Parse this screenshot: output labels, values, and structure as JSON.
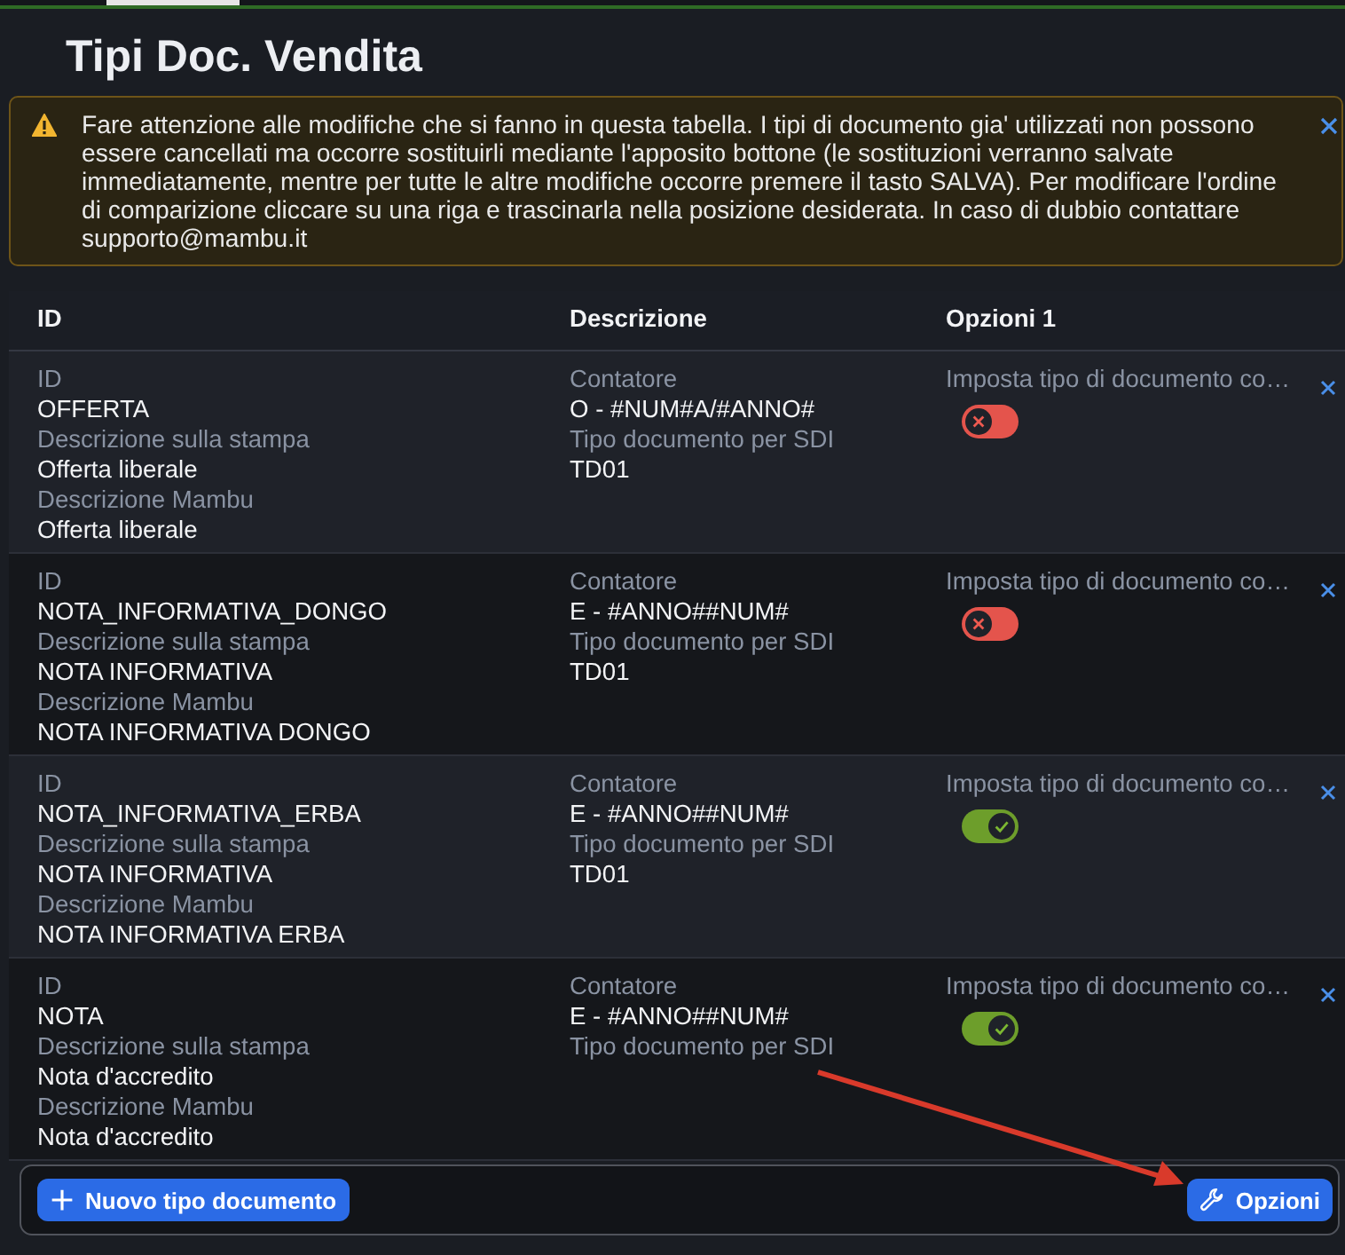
{
  "title": "Tipi Doc. Vendita",
  "alert": {
    "text": "Fare attenzione alle modifiche che si fanno in questa tabella. I tipi di documento gia' utilizzati non possono essere cancellati ma occorre sostituirli mediante l'apposito bottone (le sostituzioni verranno salvate immediatamente, mentre per tutte le altre modifiche occorre premere il tasto SALVA). Per modificare l'ordine di comparizione cliccare su una riga e trascinarla nella posizione desiderata. In caso di dubbio contattare supporto@mambu.it"
  },
  "table": {
    "columns": [
      "ID",
      "Descrizione",
      "Opzioni 1"
    ],
    "rows": [
      {
        "column_1": [
          {
            "label": "ID",
            "value": "OFFERTA"
          },
          {
            "label": "Descrizione sulla stampa",
            "value": "Offerta liberale"
          },
          {
            "label": "Descrizione Mambu",
            "value": "Offerta liberale"
          }
        ],
        "column_2": [
          {
            "label": "Contatore",
            "value": "O - #NUM#A/#ANNO#"
          },
          {
            "label": "Tipo documento per SDI",
            "value": "TD01"
          }
        ],
        "option": {
          "label": "Imposta tipo di documento co…",
          "on": false
        }
      },
      {
        "column_1": [
          {
            "label": "ID",
            "value": "NOTA_INFORMATIVA_DONGO"
          },
          {
            "label": "Descrizione sulla stampa",
            "value": "NOTA INFORMATIVA"
          },
          {
            "label": "Descrizione Mambu",
            "value": "NOTA INFORMATIVA DONGO"
          }
        ],
        "column_2": [
          {
            "label": "Contatore",
            "value": "E - #ANNO##NUM#"
          },
          {
            "label": "Tipo documento per SDI",
            "value": "TD01"
          }
        ],
        "option": {
          "label": "Imposta tipo di documento co…",
          "on": false
        }
      },
      {
        "column_1": [
          {
            "label": "ID",
            "value": "NOTA_INFORMATIVA_ERBA"
          },
          {
            "label": "Descrizione sulla stampa",
            "value": "NOTA INFORMATIVA"
          },
          {
            "label": "Descrizione Mambu",
            "value": "NOTA INFORMATIVA ERBA"
          }
        ],
        "column_2": [
          {
            "label": "Contatore",
            "value": "E - #ANNO##NUM#"
          },
          {
            "label": "Tipo documento per SDI",
            "value": "TD01"
          }
        ],
        "option": {
          "label": "Imposta tipo di documento co…",
          "on": true
        }
      },
      {
        "column_1": [
          {
            "label": "ID",
            "value": "NOTA"
          },
          {
            "label": "Descrizione sulla stampa",
            "value": "Nota d'accredito"
          },
          {
            "label": "Descrizione Mambu",
            "value": "Nota d'accredito"
          }
        ],
        "column_2": [
          {
            "label": "Contatore",
            "value": "E - #ANNO##NUM#"
          },
          {
            "label": "Tipo documento per SDI"
          }
        ],
        "option": {
          "label": "Imposta tipo di documento co…",
          "on": true
        }
      }
    ]
  },
  "footer": {
    "buttons": [
      {
        "label": "Nuovo tipo documento"
      },
      {
        "label": "Opzioni"
      }
    ]
  }
}
